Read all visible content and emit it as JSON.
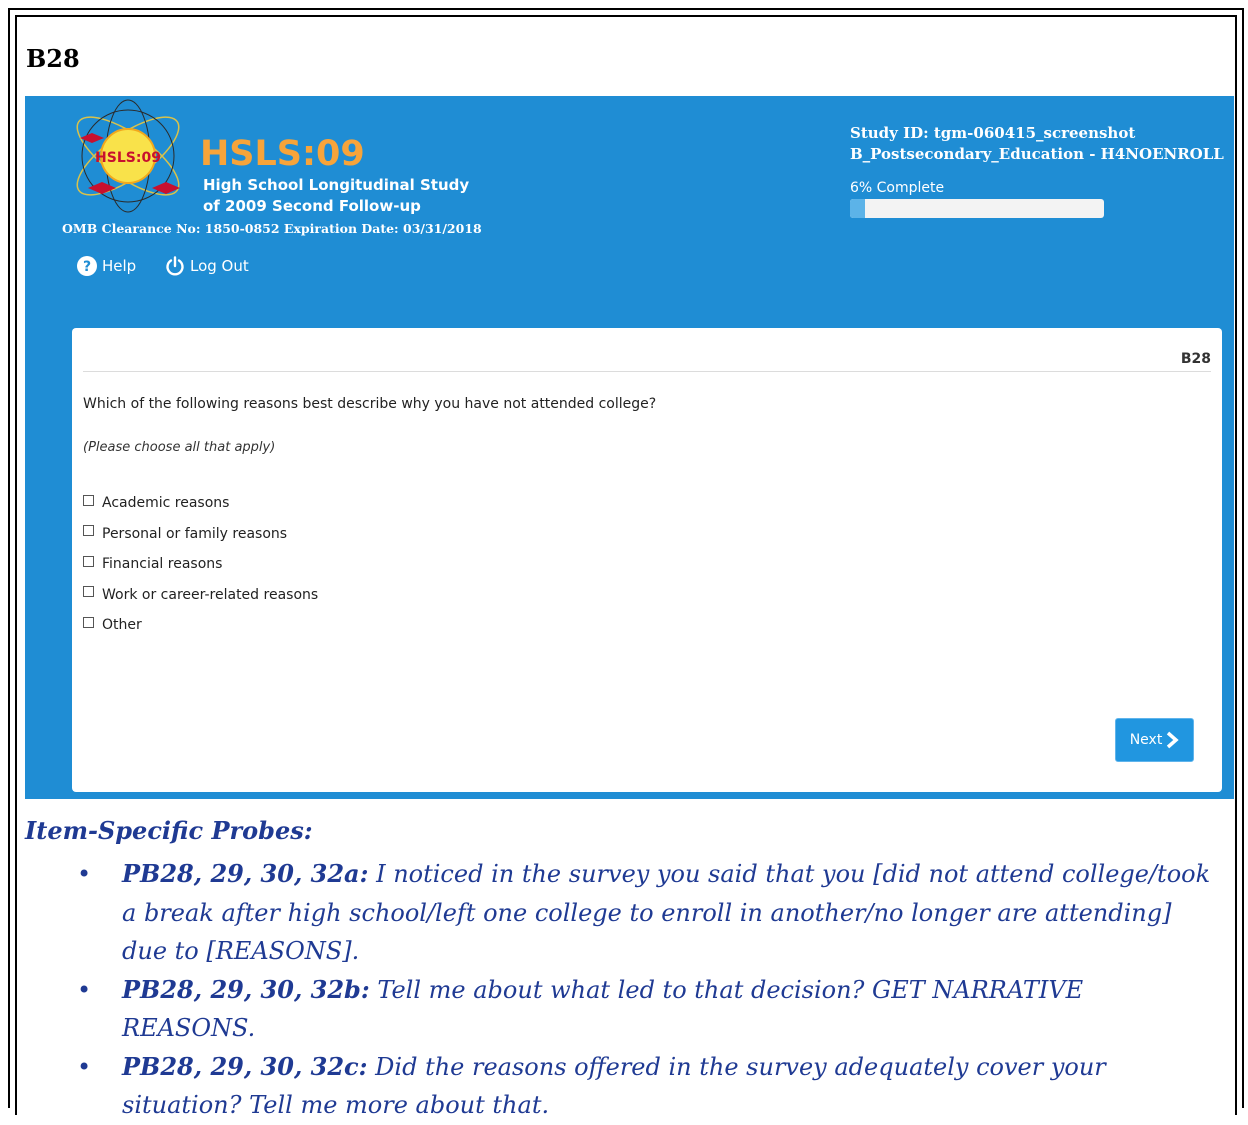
{
  "page_title": "B28",
  "header": {
    "brand_title": "HSLS:09",
    "brand_subtitle_line1": "High School Longitudinal Study",
    "brand_subtitle_line2": "of 2009 Second Follow-up",
    "omb_text": "OMB Clearance No: 1850-0852 Expiration Date: 03/31/2018",
    "help_label": "Help",
    "logout_label": "Log Out",
    "study_id": "Study ID: tgm-060415_screenshot",
    "section": "B_Postsecondary_Education - H4NOENROLL",
    "progress_text": "6% Complete",
    "progress_value": 0.06
  },
  "logo": {
    "label": "HSLS:09"
  },
  "form": {
    "item_code": "B28",
    "question": "Which of the following reasons best describe why you have not attended college?",
    "instruction": "(Please choose all that apply)",
    "options": [
      "Academic reasons",
      "Personal or family reasons",
      "Financial reasons",
      "Work or career-related reasons",
      "Other"
    ],
    "next_label": "Next"
  },
  "probes": {
    "title": "Item-Specific Probes:",
    "items": [
      {
        "code": "PB28, 29, 30, 32a:",
        "text": " I noticed in the survey you said that you [did not attend college/took a break after high school/left one college to enroll in another/no longer are attending] due to [REASONS]."
      },
      {
        "code": "PB28, 29, 30, 32b:",
        "text": " Tell me about what led to that decision?  GET NARRATIVE REASONS."
      },
      {
        "code": "PB28, 29, 30, 32c:",
        "text": " Did the reasons offered in the survey adequately cover your situation? Tell me more about that."
      }
    ]
  },
  "colors": {
    "header_blue": "#1f8dd4",
    "brand_orange": "#f7a43a",
    "probe_text": "#1f3a93",
    "button_blue": "#2196e0"
  }
}
